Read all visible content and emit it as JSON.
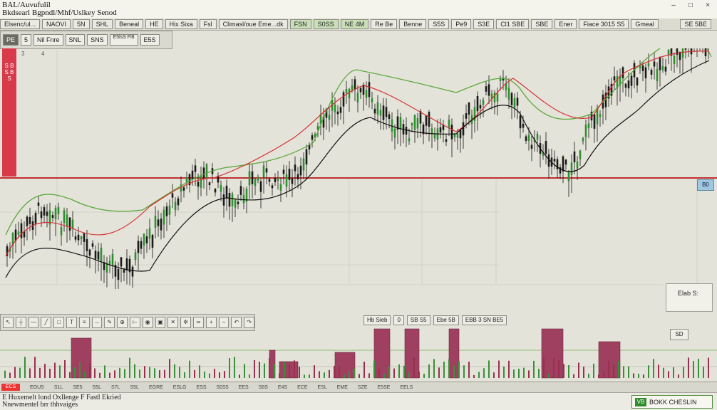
{
  "window": {
    "title_line1": "BAL/Auvufulil",
    "title_line2": "Bkdsearl Bgpndl/Mhf/Uslkey Senod",
    "controls": [
      "–",
      "□",
      "×"
    ]
  },
  "toolbar": {
    "items": [
      "Elsenc/ul...",
      "NAOVI",
      "5N",
      "SHL",
      "Beneal",
      "HE",
      "Hix Sixa",
      "Fsl",
      "Climasl/oue Eme...dk",
      "FSN",
      "S0SS",
      "NE 4M",
      "Re Be",
      "Benne",
      "S5S",
      "Pe9",
      "S3E",
      "Cl1 SBE",
      "SBE",
      "Ener",
      "Fiace 3015 S5",
      "Gmeal"
    ],
    "right_label": "SE 5BE"
  },
  "subbar": {
    "items": [
      "PE",
      "5",
      "Nil Fnre",
      "SNL",
      "SNS",
      "E5lsS Fl8",
      "E5S"
    ]
  },
  "left_panel": {
    "label": "S B S B S",
    "corner_1": "3",
    "corner_2": "4"
  },
  "price_tag": "B0",
  "info_box": "Elab S:",
  "bottom_toolbar": {
    "icons": [
      "cursor",
      "crosshair",
      "hline",
      "trend",
      "rect",
      "text",
      "fib",
      "arrow",
      "brush",
      "zoom",
      "ruler",
      "eye",
      "lock",
      "trash",
      "gear",
      "link",
      "plus",
      "minus",
      "undo",
      "redo"
    ]
  },
  "mid_tabs": [
    "Hb Sieb",
    "0",
    "SB S5",
    "Ebe 5B",
    "EBB 3 SN BE5"
  ],
  "volume_label": "SD",
  "axis_ticks": [
    "ECS",
    "EOUS",
    "S1L",
    "SE5",
    "S5L",
    "S7L",
    "S5L",
    "EGRE",
    "ESLG",
    "ESS",
    "S0S5",
    "EES",
    "S8S",
    "E4S",
    "ECE",
    "ESL",
    "EME",
    "SZE",
    "E5SE",
    "EELS"
  ],
  "status": {
    "line1": "E Huxemelt lond Oxllenge F Fastl Ekried",
    "line2": "Nnewmentel brr thhvaiges",
    "badge_text": "BOKK CHESLIN",
    "badge_logo": "VB"
  },
  "chart_data": {
    "type": "candlestick",
    "levels": {
      "horizontal_red": 0.5
    },
    "series": [],
    "colors": {
      "up": "#2f8f2f",
      "down": "#1a1a1a",
      "ma_green": "#5aa83c",
      "ma_red": "#d43030",
      "ma_black": "#111111",
      "volume": "#a04060"
    }
  }
}
